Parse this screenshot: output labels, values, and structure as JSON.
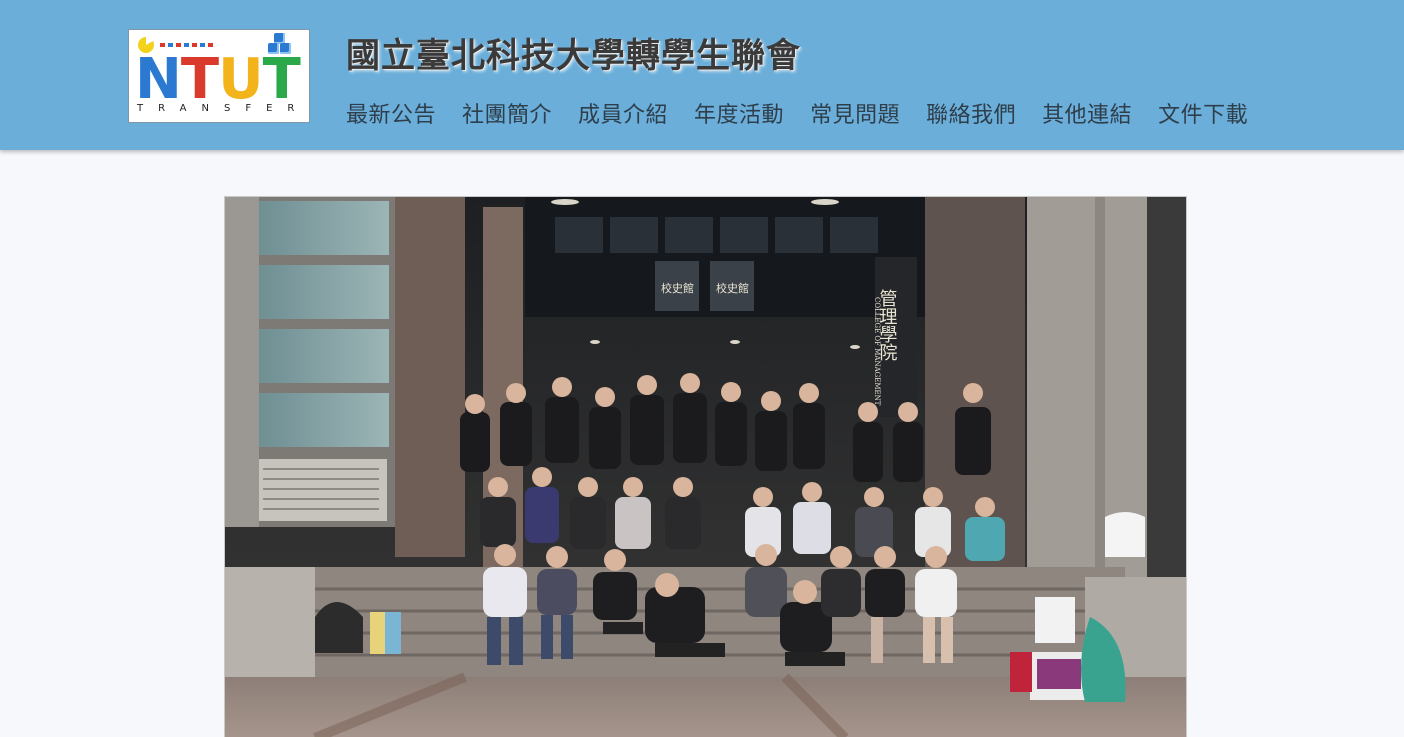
{
  "logo": {
    "word_letters": [
      "N",
      "T",
      "U",
      "T"
    ],
    "word_colors": [
      "#2b79d0",
      "#d93a2b",
      "#f2b31b",
      "#2aa84a"
    ],
    "subtitle": "TRANSFER",
    "dot_colors": [
      "#d93a2b",
      "#2b79d0",
      "#d93a2b",
      "#2b79d0",
      "#d93a2b",
      "#2b79d0",
      "#d93a2b"
    ]
  },
  "header": {
    "title": "國立臺北科技大學轉學生聯會",
    "background": "#6aaed9"
  },
  "nav": {
    "items": [
      {
        "label": "最新公告"
      },
      {
        "label": "社團簡介"
      },
      {
        "label": "成員介紹"
      },
      {
        "label": "年度活動"
      },
      {
        "label": "常見問題"
      },
      {
        "label": "聯絡我們"
      },
      {
        "label": "其他連結"
      },
      {
        "label": "文件下載"
      }
    ]
  },
  "hero": {
    "alt_description": "Group photo of association members on campus steps",
    "sign_text": "管理學院",
    "sign_subtext": "COLLEGE OF MANAGEMENT",
    "door_label": "校史館"
  }
}
